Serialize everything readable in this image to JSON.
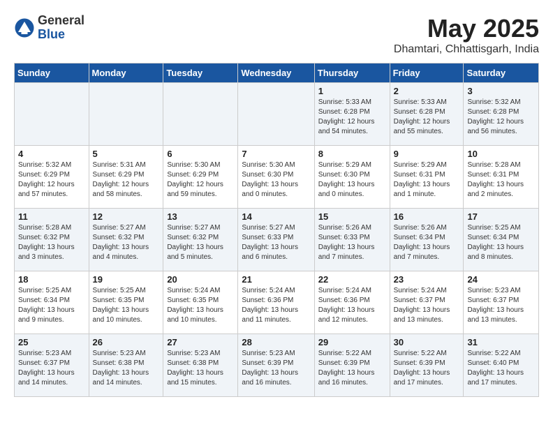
{
  "header": {
    "logo_general": "General",
    "logo_blue": "Blue",
    "month_title": "May 2025",
    "location": "Dhamtari, Chhattisgarh, India"
  },
  "columns": [
    "Sunday",
    "Monday",
    "Tuesday",
    "Wednesday",
    "Thursday",
    "Friday",
    "Saturday"
  ],
  "weeks": [
    {
      "days": [
        {
          "num": "",
          "info": ""
        },
        {
          "num": "",
          "info": ""
        },
        {
          "num": "",
          "info": ""
        },
        {
          "num": "",
          "info": ""
        },
        {
          "num": "1",
          "info": "Sunrise: 5:33 AM\nSunset: 6:28 PM\nDaylight: 12 hours\nand 54 minutes."
        },
        {
          "num": "2",
          "info": "Sunrise: 5:33 AM\nSunset: 6:28 PM\nDaylight: 12 hours\nand 55 minutes."
        },
        {
          "num": "3",
          "info": "Sunrise: 5:32 AM\nSunset: 6:28 PM\nDaylight: 12 hours\nand 56 minutes."
        }
      ]
    },
    {
      "days": [
        {
          "num": "4",
          "info": "Sunrise: 5:32 AM\nSunset: 6:29 PM\nDaylight: 12 hours\nand 57 minutes."
        },
        {
          "num": "5",
          "info": "Sunrise: 5:31 AM\nSunset: 6:29 PM\nDaylight: 12 hours\nand 58 minutes."
        },
        {
          "num": "6",
          "info": "Sunrise: 5:30 AM\nSunset: 6:29 PM\nDaylight: 12 hours\nand 59 minutes."
        },
        {
          "num": "7",
          "info": "Sunrise: 5:30 AM\nSunset: 6:30 PM\nDaylight: 13 hours\nand 0 minutes."
        },
        {
          "num": "8",
          "info": "Sunrise: 5:29 AM\nSunset: 6:30 PM\nDaylight: 13 hours\nand 0 minutes."
        },
        {
          "num": "9",
          "info": "Sunrise: 5:29 AM\nSunset: 6:31 PM\nDaylight: 13 hours\nand 1 minute."
        },
        {
          "num": "10",
          "info": "Sunrise: 5:28 AM\nSunset: 6:31 PM\nDaylight: 13 hours\nand 2 minutes."
        }
      ]
    },
    {
      "days": [
        {
          "num": "11",
          "info": "Sunrise: 5:28 AM\nSunset: 6:32 PM\nDaylight: 13 hours\nand 3 minutes."
        },
        {
          "num": "12",
          "info": "Sunrise: 5:27 AM\nSunset: 6:32 PM\nDaylight: 13 hours\nand 4 minutes."
        },
        {
          "num": "13",
          "info": "Sunrise: 5:27 AM\nSunset: 6:32 PM\nDaylight: 13 hours\nand 5 minutes."
        },
        {
          "num": "14",
          "info": "Sunrise: 5:27 AM\nSunset: 6:33 PM\nDaylight: 13 hours\nand 6 minutes."
        },
        {
          "num": "15",
          "info": "Sunrise: 5:26 AM\nSunset: 6:33 PM\nDaylight: 13 hours\nand 7 minutes."
        },
        {
          "num": "16",
          "info": "Sunrise: 5:26 AM\nSunset: 6:34 PM\nDaylight: 13 hours\nand 7 minutes."
        },
        {
          "num": "17",
          "info": "Sunrise: 5:25 AM\nSunset: 6:34 PM\nDaylight: 13 hours\nand 8 minutes."
        }
      ]
    },
    {
      "days": [
        {
          "num": "18",
          "info": "Sunrise: 5:25 AM\nSunset: 6:34 PM\nDaylight: 13 hours\nand 9 minutes."
        },
        {
          "num": "19",
          "info": "Sunrise: 5:25 AM\nSunset: 6:35 PM\nDaylight: 13 hours\nand 10 minutes."
        },
        {
          "num": "20",
          "info": "Sunrise: 5:24 AM\nSunset: 6:35 PM\nDaylight: 13 hours\nand 10 minutes."
        },
        {
          "num": "21",
          "info": "Sunrise: 5:24 AM\nSunset: 6:36 PM\nDaylight: 13 hours\nand 11 minutes."
        },
        {
          "num": "22",
          "info": "Sunrise: 5:24 AM\nSunset: 6:36 PM\nDaylight: 13 hours\nand 12 minutes."
        },
        {
          "num": "23",
          "info": "Sunrise: 5:24 AM\nSunset: 6:37 PM\nDaylight: 13 hours\nand 13 minutes."
        },
        {
          "num": "24",
          "info": "Sunrise: 5:23 AM\nSunset: 6:37 PM\nDaylight: 13 hours\nand 13 minutes."
        }
      ]
    },
    {
      "days": [
        {
          "num": "25",
          "info": "Sunrise: 5:23 AM\nSunset: 6:37 PM\nDaylight: 13 hours\nand 14 minutes."
        },
        {
          "num": "26",
          "info": "Sunrise: 5:23 AM\nSunset: 6:38 PM\nDaylight: 13 hours\nand 14 minutes."
        },
        {
          "num": "27",
          "info": "Sunrise: 5:23 AM\nSunset: 6:38 PM\nDaylight: 13 hours\nand 15 minutes."
        },
        {
          "num": "28",
          "info": "Sunrise: 5:23 AM\nSunset: 6:39 PM\nDaylight: 13 hours\nand 16 minutes."
        },
        {
          "num": "29",
          "info": "Sunrise: 5:22 AM\nSunset: 6:39 PM\nDaylight: 13 hours\nand 16 minutes."
        },
        {
          "num": "30",
          "info": "Sunrise: 5:22 AM\nSunset: 6:39 PM\nDaylight: 13 hours\nand 17 minutes."
        },
        {
          "num": "31",
          "info": "Sunrise: 5:22 AM\nSunset: 6:40 PM\nDaylight: 13 hours\nand 17 minutes."
        }
      ]
    }
  ]
}
